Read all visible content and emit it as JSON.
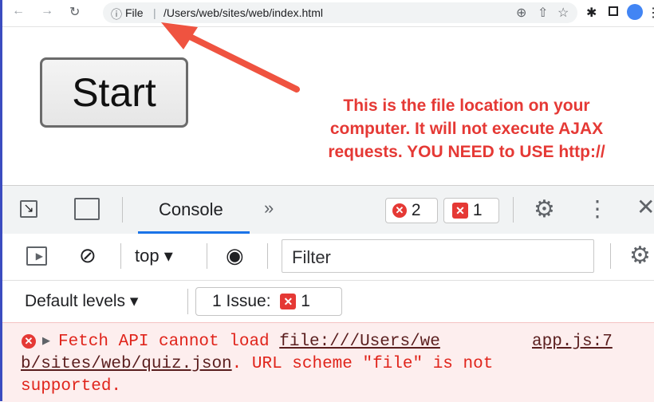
{
  "browser": {
    "url_scheme_label": "File",
    "url_path": "/Users/web/sites/web/index.html",
    "icons": [
      "back-icon",
      "forward-icon",
      "reload-icon",
      "info-icon",
      "zoom-icon",
      "share-icon",
      "star-icon",
      "extensions-icon",
      "sidepanel-icon",
      "profile-icon",
      "menu-icon"
    ]
  },
  "page": {
    "start_label": "Start",
    "note_lines": [
      "This is the file location on your",
      "computer.  It will not execute AJAX",
      "requests.  YOU NEED to USE http://"
    ],
    "note_color": "#e53935"
  },
  "devtools": {
    "tab_console": "Console",
    "more_tabs": "»",
    "error_count": "2",
    "issue_count": "1",
    "context": "top",
    "filter_placeholder": "Filter",
    "levels": "Default levels",
    "issues_label": "1 Issue:",
    "issues_count": "1"
  },
  "console": {
    "message_prefix": "Fetch API cannot load ",
    "url_part1": "file:///Users/we",
    "url_part2": "b/sites/web/quiz.json",
    "message_suffix": ". URL scheme \"file\" is not",
    "message_line3": "supported.",
    "source": "app.js:7"
  }
}
